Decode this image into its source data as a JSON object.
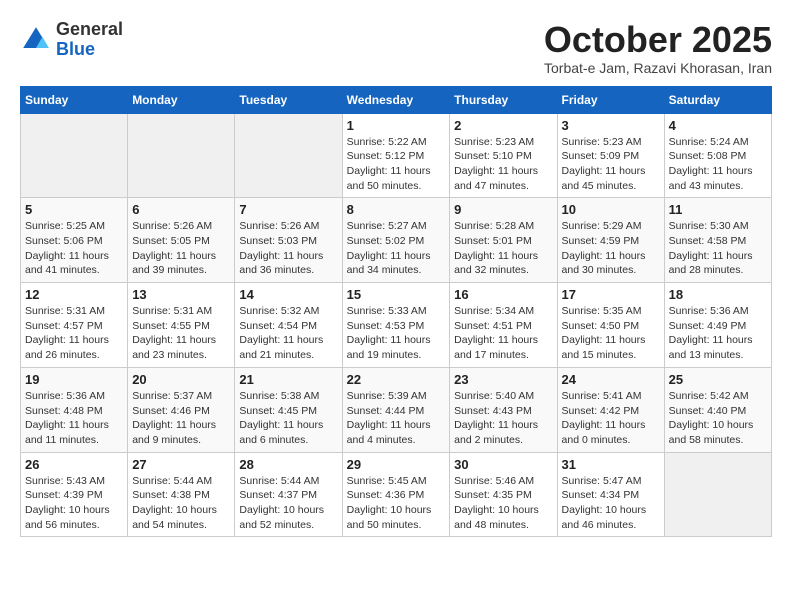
{
  "header": {
    "logo_line1": "General",
    "logo_line2": "Blue",
    "month_title": "October 2025",
    "location": "Torbat-e Jam, Razavi Khorasan, Iran"
  },
  "weekdays": [
    "Sunday",
    "Monday",
    "Tuesday",
    "Wednesday",
    "Thursday",
    "Friday",
    "Saturday"
  ],
  "weeks": [
    [
      {
        "day": "",
        "info": ""
      },
      {
        "day": "",
        "info": ""
      },
      {
        "day": "",
        "info": ""
      },
      {
        "day": "1",
        "info": "Sunrise: 5:22 AM\nSunset: 5:12 PM\nDaylight: 11 hours\nand 50 minutes."
      },
      {
        "day": "2",
        "info": "Sunrise: 5:23 AM\nSunset: 5:10 PM\nDaylight: 11 hours\nand 47 minutes."
      },
      {
        "day": "3",
        "info": "Sunrise: 5:23 AM\nSunset: 5:09 PM\nDaylight: 11 hours\nand 45 minutes."
      },
      {
        "day": "4",
        "info": "Sunrise: 5:24 AM\nSunset: 5:08 PM\nDaylight: 11 hours\nand 43 minutes."
      }
    ],
    [
      {
        "day": "5",
        "info": "Sunrise: 5:25 AM\nSunset: 5:06 PM\nDaylight: 11 hours\nand 41 minutes."
      },
      {
        "day": "6",
        "info": "Sunrise: 5:26 AM\nSunset: 5:05 PM\nDaylight: 11 hours\nand 39 minutes."
      },
      {
        "day": "7",
        "info": "Sunrise: 5:26 AM\nSunset: 5:03 PM\nDaylight: 11 hours\nand 36 minutes."
      },
      {
        "day": "8",
        "info": "Sunrise: 5:27 AM\nSunset: 5:02 PM\nDaylight: 11 hours\nand 34 minutes."
      },
      {
        "day": "9",
        "info": "Sunrise: 5:28 AM\nSunset: 5:01 PM\nDaylight: 11 hours\nand 32 minutes."
      },
      {
        "day": "10",
        "info": "Sunrise: 5:29 AM\nSunset: 4:59 PM\nDaylight: 11 hours\nand 30 minutes."
      },
      {
        "day": "11",
        "info": "Sunrise: 5:30 AM\nSunset: 4:58 PM\nDaylight: 11 hours\nand 28 minutes."
      }
    ],
    [
      {
        "day": "12",
        "info": "Sunrise: 5:31 AM\nSunset: 4:57 PM\nDaylight: 11 hours\nand 26 minutes."
      },
      {
        "day": "13",
        "info": "Sunrise: 5:31 AM\nSunset: 4:55 PM\nDaylight: 11 hours\nand 23 minutes."
      },
      {
        "day": "14",
        "info": "Sunrise: 5:32 AM\nSunset: 4:54 PM\nDaylight: 11 hours\nand 21 minutes."
      },
      {
        "day": "15",
        "info": "Sunrise: 5:33 AM\nSunset: 4:53 PM\nDaylight: 11 hours\nand 19 minutes."
      },
      {
        "day": "16",
        "info": "Sunrise: 5:34 AM\nSunset: 4:51 PM\nDaylight: 11 hours\nand 17 minutes."
      },
      {
        "day": "17",
        "info": "Sunrise: 5:35 AM\nSunset: 4:50 PM\nDaylight: 11 hours\nand 15 minutes."
      },
      {
        "day": "18",
        "info": "Sunrise: 5:36 AM\nSunset: 4:49 PM\nDaylight: 11 hours\nand 13 minutes."
      }
    ],
    [
      {
        "day": "19",
        "info": "Sunrise: 5:36 AM\nSunset: 4:48 PM\nDaylight: 11 hours\nand 11 minutes."
      },
      {
        "day": "20",
        "info": "Sunrise: 5:37 AM\nSunset: 4:46 PM\nDaylight: 11 hours\nand 9 minutes."
      },
      {
        "day": "21",
        "info": "Sunrise: 5:38 AM\nSunset: 4:45 PM\nDaylight: 11 hours\nand 6 minutes."
      },
      {
        "day": "22",
        "info": "Sunrise: 5:39 AM\nSunset: 4:44 PM\nDaylight: 11 hours\nand 4 minutes."
      },
      {
        "day": "23",
        "info": "Sunrise: 5:40 AM\nSunset: 4:43 PM\nDaylight: 11 hours\nand 2 minutes."
      },
      {
        "day": "24",
        "info": "Sunrise: 5:41 AM\nSunset: 4:42 PM\nDaylight: 11 hours\nand 0 minutes."
      },
      {
        "day": "25",
        "info": "Sunrise: 5:42 AM\nSunset: 4:40 PM\nDaylight: 10 hours\nand 58 minutes."
      }
    ],
    [
      {
        "day": "26",
        "info": "Sunrise: 5:43 AM\nSunset: 4:39 PM\nDaylight: 10 hours\nand 56 minutes."
      },
      {
        "day": "27",
        "info": "Sunrise: 5:44 AM\nSunset: 4:38 PM\nDaylight: 10 hours\nand 54 minutes."
      },
      {
        "day": "28",
        "info": "Sunrise: 5:44 AM\nSunset: 4:37 PM\nDaylight: 10 hours\nand 52 minutes."
      },
      {
        "day": "29",
        "info": "Sunrise: 5:45 AM\nSunset: 4:36 PM\nDaylight: 10 hours\nand 50 minutes."
      },
      {
        "day": "30",
        "info": "Sunrise: 5:46 AM\nSunset: 4:35 PM\nDaylight: 10 hours\nand 48 minutes."
      },
      {
        "day": "31",
        "info": "Sunrise: 5:47 AM\nSunset: 4:34 PM\nDaylight: 10 hours\nand 46 minutes."
      },
      {
        "day": "",
        "info": ""
      }
    ]
  ]
}
